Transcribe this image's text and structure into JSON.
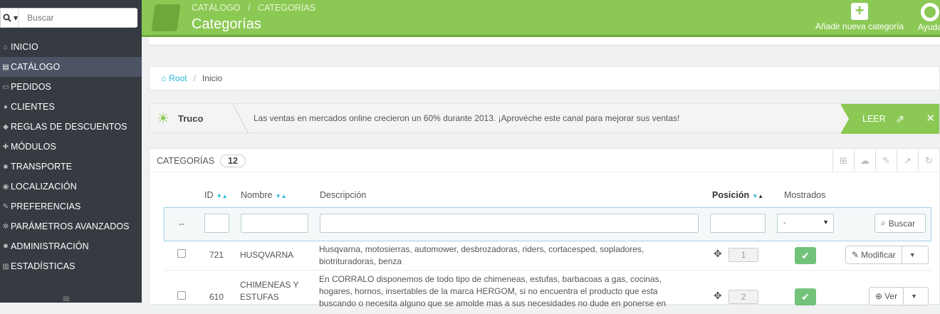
{
  "search": {
    "placeholder": "Buscar"
  },
  "sidebar": {
    "items": [
      {
        "label": "INICIO",
        "icon": "home-icon"
      },
      {
        "label": "CATÁLOGO",
        "icon": "book-icon",
        "active": true
      },
      {
        "label": "PEDIDOS",
        "icon": "credit-card-icon"
      },
      {
        "label": "CLIENTES",
        "icon": "users-icon"
      },
      {
        "label": "REGLAS DE DESCUENTOS",
        "icon": "tags-icon"
      },
      {
        "label": "MÓDULOS",
        "icon": "puzzle-icon"
      },
      {
        "label": "TRANSPORTE",
        "icon": "truck-icon"
      },
      {
        "label": "LOCALIZACIÓN",
        "icon": "globe-icon"
      },
      {
        "label": "PREFERENCIAS",
        "icon": "wrench-icon"
      },
      {
        "label": "PARÁMETROS AVANZADOS",
        "icon": "cogs-icon"
      },
      {
        "label": "ADMINISTRACIÓN",
        "icon": "gear-icon"
      },
      {
        "label": "ESTADÍSTICAS",
        "icon": "bar-chart-icon"
      }
    ]
  },
  "header": {
    "crumb1": "CATÁLOGO",
    "crumb_sep": "/",
    "crumb2": "CATEGORÍAS",
    "title": "Categorías",
    "add_label": "Añadir nueva categoría",
    "help_label": "Ayuda"
  },
  "breadcrumb": {
    "root": "Root",
    "sep": "/",
    "current": "Inicio"
  },
  "tip": {
    "label": "Truco",
    "message": "Las ventas en mercados online crecieron un 60% durante 2013. ¡Aprovéche este canal para mejorar sus ventas!",
    "read_label": "LEER",
    "close": "✕"
  },
  "list": {
    "title": "CATEGORÍAS",
    "count": "12",
    "columns": {
      "id": "ID",
      "name": "Nombre",
      "description": "Descripción",
      "position": "Posición",
      "shown": "Mostrados"
    },
    "filter_dash": "--",
    "filter_select": "-",
    "search_button": "Buscar",
    "rows": [
      {
        "id": "721",
        "name": "HUSQVARNA",
        "desc1": "Husqvarna, motosierras, automower, desbrozadoras, riders, cortacesped, sopladores,",
        "desc2": "biotrituradoras, benza",
        "position": "1",
        "action": "Modificar"
      },
      {
        "id": "610",
        "name1": "CHIMENEAS Y",
        "name2": "ESTUFAS",
        "desc1": "En CORRALO disponemos de todo tipo de chimeneas, estufas, barbacoas a gas, cocinas,",
        "desc2": "hogares, hornos, insertables de la marca HERGOM, si no encuentra el producto que esta",
        "desc3": "buscando o necesita alguno que se amolde mas a sus necesidades no dude en ponerse en",
        "position": "2",
        "action": "Ver"
      }
    ]
  },
  "colors": {
    "green": "#8bc954",
    "sidebar": "#363a41",
    "link": "#25b9d7"
  }
}
